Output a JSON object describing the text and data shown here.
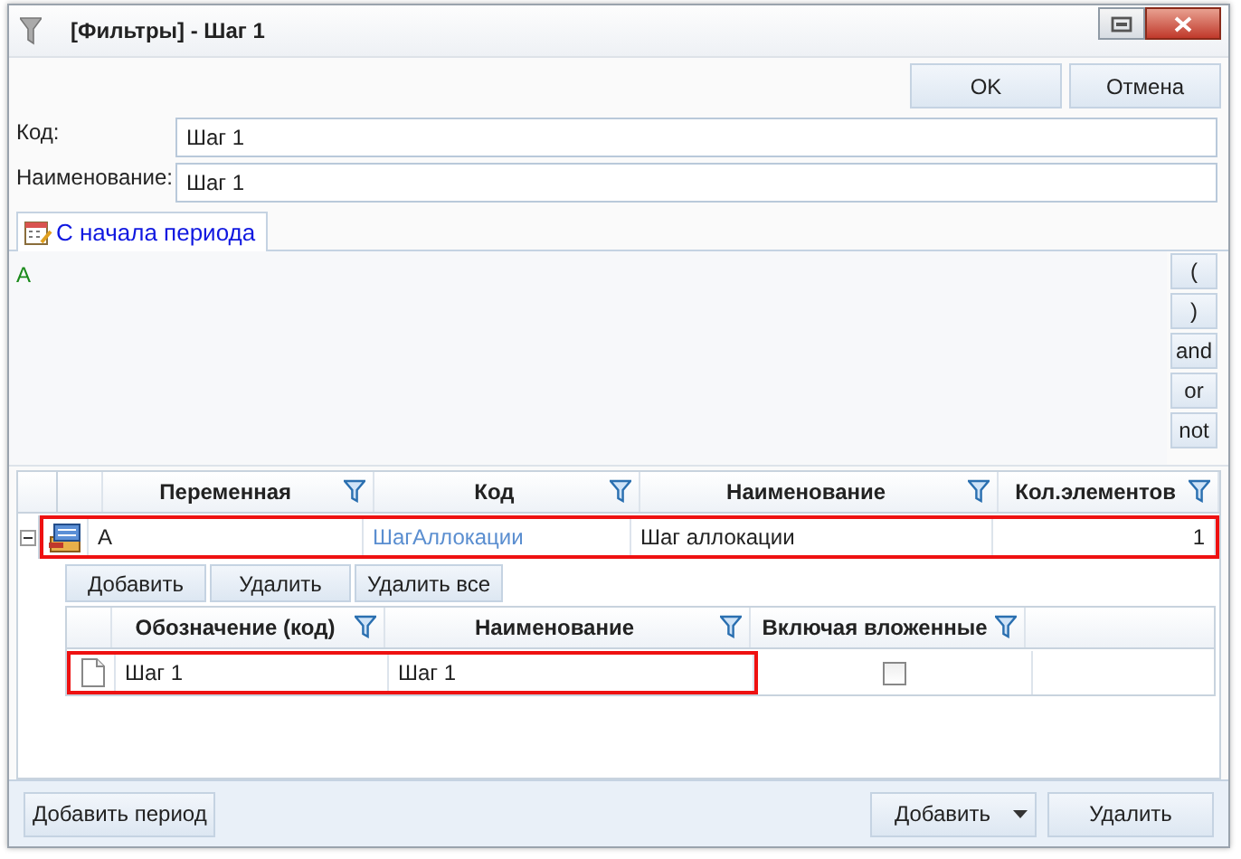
{
  "window": {
    "title": "[Фильтры] - Шаг 1"
  },
  "top_buttons": [
    "OK",
    "Отмена"
  ],
  "fields": [
    {
      "label": "Код:",
      "value": "Шаг 1"
    },
    {
      "label": "Наименование:",
      "value": "Шаг 1"
    }
  ],
  "tabs": [
    {
      "label": "С начала периода",
      "selected": true
    }
  ],
  "expression": "A",
  "operator_buttons": [
    "(",
    ")",
    "and",
    "or",
    "not"
  ],
  "variables_table": {
    "columns": [
      "Переменная",
      "Код",
      "Наименование",
      "Кол.элементов"
    ],
    "rows": [
      {
        "expanded": true,
        "highlighted": true,
        "cells": [
          "A",
          "ШагАллокации",
          "Шаг аллокации",
          "1"
        ]
      }
    ]
  },
  "details_toolbar": [
    "Добавить",
    "Удалить",
    "Удалить все"
  ],
  "details_table": {
    "columns": [
      "Обозначение (код)",
      "Наименование",
      "Включая вложенные"
    ],
    "rows": [
      {
        "code": "Шаг 1",
        "name": "Шаг 1",
        "include_nested": false,
        "highlighted": true
      }
    ]
  },
  "footer": {
    "left_button": "Добавить период",
    "right_buttons": [
      {
        "label": "Добавить",
        "dropdown": true
      },
      {
        "label": "Удалить",
        "dropdown": false
      }
    ]
  }
}
